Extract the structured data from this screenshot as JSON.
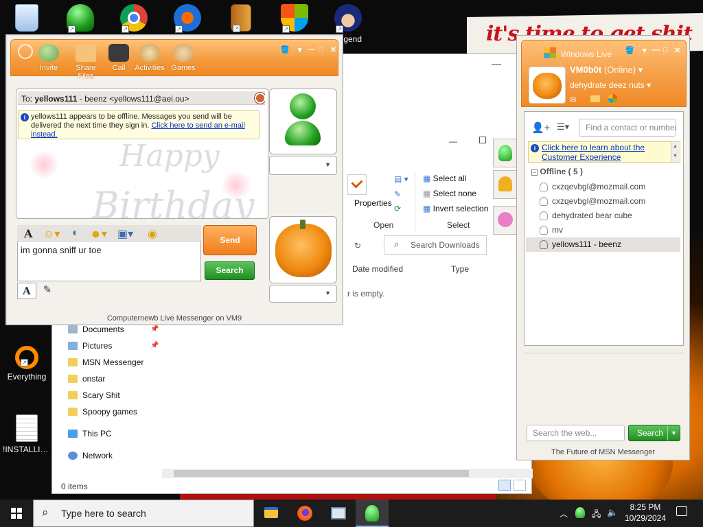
{
  "desktop": {
    "wallpaper_text": "it's time to get shit",
    "icons": [
      {
        "label": "",
        "icon": "recycle-bin-icon"
      },
      {
        "label": "",
        "icon": "msn-messenger-icon"
      },
      {
        "label": "",
        "icon": "chrome-icon"
      },
      {
        "label": "",
        "icon": "app-shortcut-icon"
      },
      {
        "label": "",
        "icon": "installer-icon"
      },
      {
        "label": "",
        "icon": "windows-shield-icon"
      },
      {
        "label": "Legend",
        "icon": "game-character-icon"
      },
      {
        "label": "Everything",
        "icon": "search-tool-icon"
      },
      {
        "label": "!INSTALLIN...",
        "icon": "document-icon"
      }
    ]
  },
  "explorer": {
    "ribbon": {
      "properties": "Properties",
      "open_group": "Open",
      "select_all": "Select all",
      "select_none": "Select none",
      "invert_selection": "Invert selection",
      "select_group": "Select"
    },
    "search_placeholder": "Search Downloads",
    "columns": [
      "Date modified",
      "Type"
    ],
    "empty_text": "r is empty.",
    "nav": [
      {
        "label": "Documents",
        "type": "quick",
        "pinned": true
      },
      {
        "label": "Pictures",
        "type": "quick",
        "pinned": true
      },
      {
        "label": "MSN Messenger",
        "type": "folder"
      },
      {
        "label": "onstar",
        "type": "folder"
      },
      {
        "label": "Scary Shit",
        "type": "folder"
      },
      {
        "label": "Spoopy games",
        "type": "folder"
      },
      {
        "label": "This PC",
        "type": "pc"
      },
      {
        "label": "Network",
        "type": "network"
      }
    ],
    "status": "0 items"
  },
  "conversation": {
    "toolbar": [
      "Invite",
      "Share Files",
      "Call",
      "Activities",
      "Games"
    ],
    "to_label": "To:",
    "to_name": "yellows111",
    "to_detail": " - beenz <yellows111@aei.ou>",
    "info_text": "yellows111 appears to be offline. Messages you send will be delivered the next time they sign in. ",
    "info_link": "Click here to send an e-mail instead.",
    "background_text": [
      "Happy",
      "Birthday"
    ],
    "input_value": "im gonna sniff ur toe",
    "send_label": "Send",
    "search_label": "Search",
    "status_bar": "Computernewb Live Messenger on VM9"
  },
  "contact_list": {
    "title": "Windows Live",
    "username": "VM0b0t",
    "status": "(Online)",
    "personal_message": "dehydrate deez nuts",
    "find_placeholder": "Find a contact or number",
    "learn_link": "Click here to learn about the Customer Experience",
    "group": "Offline ( 5 )",
    "contacts": [
      {
        "name": "cxzqevbgl@mozmail.com",
        "selected": false
      },
      {
        "name": "cxzqevbgl@mozmail.com",
        "selected": false
      },
      {
        "name": "dehydrated bear cube",
        "selected": false
      },
      {
        "name": "mv",
        "selected": false
      },
      {
        "name": "yellows111 - beenz",
        "selected": true
      }
    ],
    "web_search_placeholder": "Search the web...",
    "search_label": "Search",
    "footer": "The Future of MSN Messenger"
  },
  "taskbar": {
    "search_placeholder": "Type here to search",
    "apps": [
      "file-explorer-icon",
      "firefox-icon",
      "screen-app-icon",
      "msn-messenger-icon"
    ],
    "time": "8:25 PM",
    "date": "10/29/2024"
  },
  "colors": {
    "msn_orange": "#f39a3a",
    "msn_green": "#1f8f1f",
    "link_blue": "#0033cc",
    "wallpaper_red": "#c8131f"
  }
}
